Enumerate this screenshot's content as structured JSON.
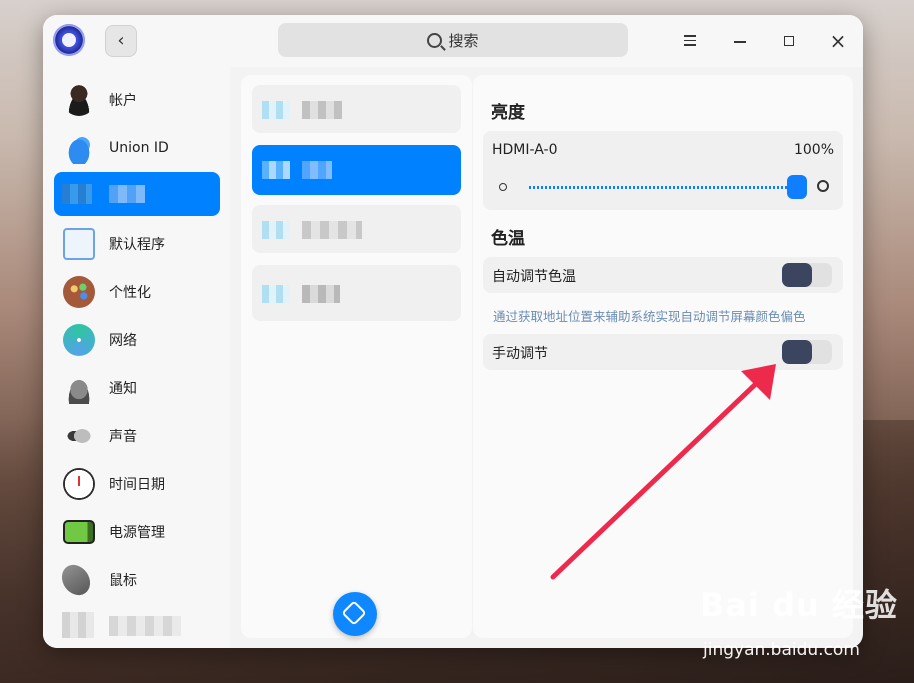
{
  "search": {
    "label": "搜索"
  },
  "sidebar": {
    "items": [
      {
        "label": "帐户",
        "icon": "user-icon"
      },
      {
        "label": "Union ID",
        "icon": "cloud-icon"
      },
      {
        "label": "",
        "icon": "display-icon"
      },
      {
        "label": "默认程序",
        "icon": "default-apps-icon"
      },
      {
        "label": "个性化",
        "icon": "palette-icon"
      },
      {
        "label": "网络",
        "icon": "network-icon"
      },
      {
        "label": "通知",
        "icon": "bell-icon"
      },
      {
        "label": "声音",
        "icon": "speaker-icon"
      },
      {
        "label": "时间日期",
        "icon": "clock-icon"
      },
      {
        "label": "电源管理",
        "icon": "battery-icon"
      },
      {
        "label": "鼠标",
        "icon": "mouse-icon"
      }
    ]
  },
  "brightness": {
    "title": "亮度",
    "monitor": "HDMI-A-0",
    "percent_label": "100%",
    "value": 100
  },
  "color_temp": {
    "title": "色温",
    "auto_label": "自动调节色温",
    "auto_on": false,
    "hint": "通过获取地址位置来辅助系统实现自动调节屏幕颜色偏色",
    "manual_label": "手动调节",
    "manual_on": false
  },
  "watermark": {
    "logo": "Bai du 经验",
    "site": "jingyan.baidu.com"
  },
  "colors": {
    "accent": "#0081ff",
    "toggle_knob": "#3b4560",
    "arrow": "#ee2a4c"
  }
}
